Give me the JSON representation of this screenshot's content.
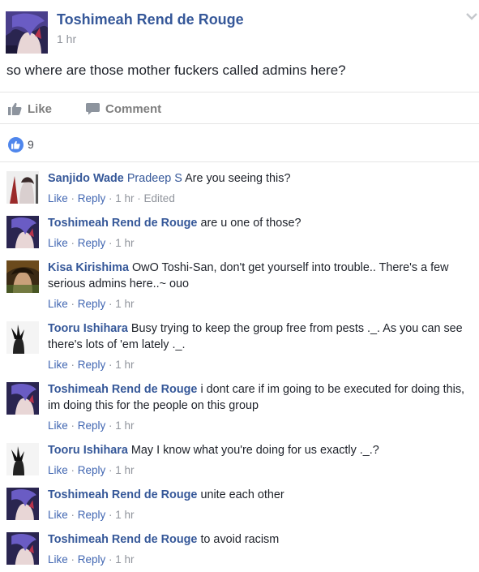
{
  "post": {
    "author": "Toshimeah Rend de Rouge",
    "time": "1 hr",
    "text": "so where are those mother fuckers called admins here?"
  },
  "actions": {
    "like": "Like",
    "comment": "Comment"
  },
  "reactions": {
    "count": "9"
  },
  "colors": {
    "link": "#365899",
    "meta": "#90949c",
    "like_badge": "#4f86ec"
  },
  "comments": [
    {
      "avatar": "avatar-sanjido",
      "author": "Sanjido Wade",
      "tag": "Pradeep S",
      "text": "Are you seeing this?",
      "like": "Like",
      "reply": "Reply",
      "time": "1 hr",
      "edited": "Edited"
    },
    {
      "avatar": "avatar-toshimeah",
      "author": "Toshimeah Rend de Rouge",
      "text": "are u one of those?",
      "like": "Like",
      "reply": "Reply",
      "time": "1 hr"
    },
    {
      "avatar": "avatar-kisa",
      "author": "Kisa Kirishima",
      "text": "OwO Toshi-San, don't get yourself into trouble.. There's a few serious admins here..~ ouo",
      "like": "Like",
      "reply": "Reply",
      "time": "1 hr"
    },
    {
      "avatar": "avatar-tooru",
      "author": "Tooru Ishihara",
      "text": "Busy trying to keep the group free from pests ._. As you can see there's lots of 'em lately ._.",
      "like": "Like",
      "reply": "Reply",
      "time": "1 hr"
    },
    {
      "avatar": "avatar-toshimeah",
      "author": "Toshimeah Rend de Rouge",
      "text": "i dont care if im going to be executed for doing this, im doing this for the people on this group",
      "like": "Like",
      "reply": "Reply",
      "time": "1 hr"
    },
    {
      "avatar": "avatar-tooru",
      "author": "Tooru Ishihara",
      "text": "May I know what you're doing for us exactly ._.?",
      "like": "Like",
      "reply": "Reply",
      "time": "1 hr"
    },
    {
      "avatar": "avatar-toshimeah",
      "author": "Toshimeah Rend de Rouge",
      "text": "unite each other",
      "like": "Like",
      "reply": "Reply",
      "time": "1 hr"
    },
    {
      "avatar": "avatar-toshimeah",
      "author": "Toshimeah Rend de Rouge",
      "text": "to avoid racism",
      "like": "Like",
      "reply": "Reply",
      "time": "1 hr"
    }
  ]
}
